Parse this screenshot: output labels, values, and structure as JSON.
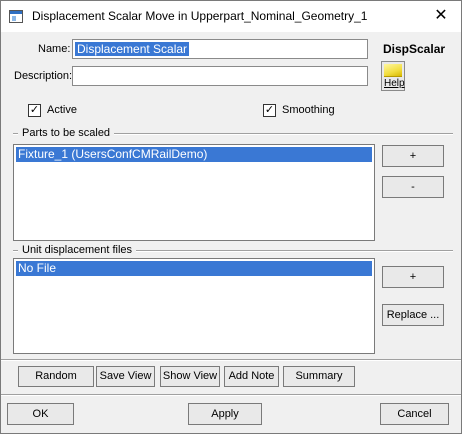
{
  "window": {
    "title": "Displacement Scalar Move in Upperpart_Nominal_Geometry_1",
    "close_symbol": "✕",
    "app_icon": "window-icon",
    "close_icon": "close-icon"
  },
  "form": {
    "name_label": "Name:",
    "name_value": "Displacement Scalar",
    "description_label": "Description:",
    "description_value": "",
    "header": "DispScalar",
    "help_label": "Help",
    "help_icon": "help-book-icon"
  },
  "options": {
    "active_label": "Active",
    "active_checked": true,
    "smoothing_label": "Smoothing",
    "smoothing_checked": true,
    "check_glyph": "✓"
  },
  "parts": {
    "label": "Parts to be scaled",
    "items": [
      "Fixture_1 (UsersConfCMRailDemo)"
    ],
    "add_label": "+",
    "remove_label": "-"
  },
  "files": {
    "label": "Unit displacement files",
    "items": [
      "No File"
    ],
    "add_label": "+",
    "replace_label": "Replace ..."
  },
  "toolbar": {
    "random": "Random",
    "save_view": "Save View",
    "show_view": "Show View",
    "add_note": "Add Note",
    "summary": "Summary"
  },
  "footer": {
    "ok": "OK",
    "apply": "Apply",
    "cancel": "Cancel"
  }
}
